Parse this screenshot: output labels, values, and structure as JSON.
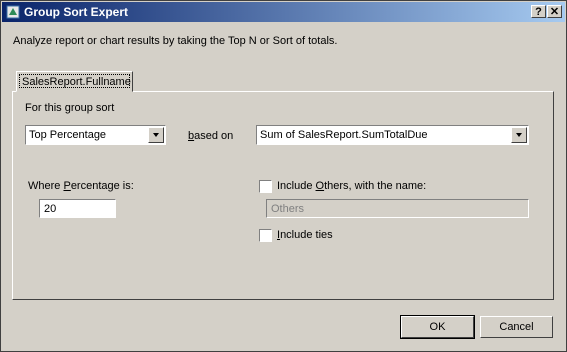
{
  "window": {
    "title": "Group Sort Expert",
    "help_btn": "?",
    "close_btn": "✕",
    "description": "Analyze report or chart results by taking the Top N or Sort of totals."
  },
  "tab": {
    "label": "SalesReport.Fullname"
  },
  "group_sort": {
    "label_pre": "For this ",
    "label_u": "g",
    "label_post": "roup sort",
    "sort_type": "Top Percentage",
    "based_on_u": "b",
    "based_on_post": "ased on",
    "based_on_value": "Sum of SalesReport.SumTotalDue"
  },
  "percentage": {
    "label_pre": "Where ",
    "label_u": "P",
    "label_post": "ercentage is:",
    "value": "20"
  },
  "others": {
    "label_pre": "Include ",
    "label_u": "O",
    "label_post": "thers, with the name:",
    "checked": false,
    "name_value": "Others"
  },
  "ties": {
    "label_pre": "",
    "label_u": "I",
    "label_post": "nclude ties",
    "checked": false
  },
  "buttons": {
    "ok": "OK",
    "cancel": "Cancel"
  }
}
